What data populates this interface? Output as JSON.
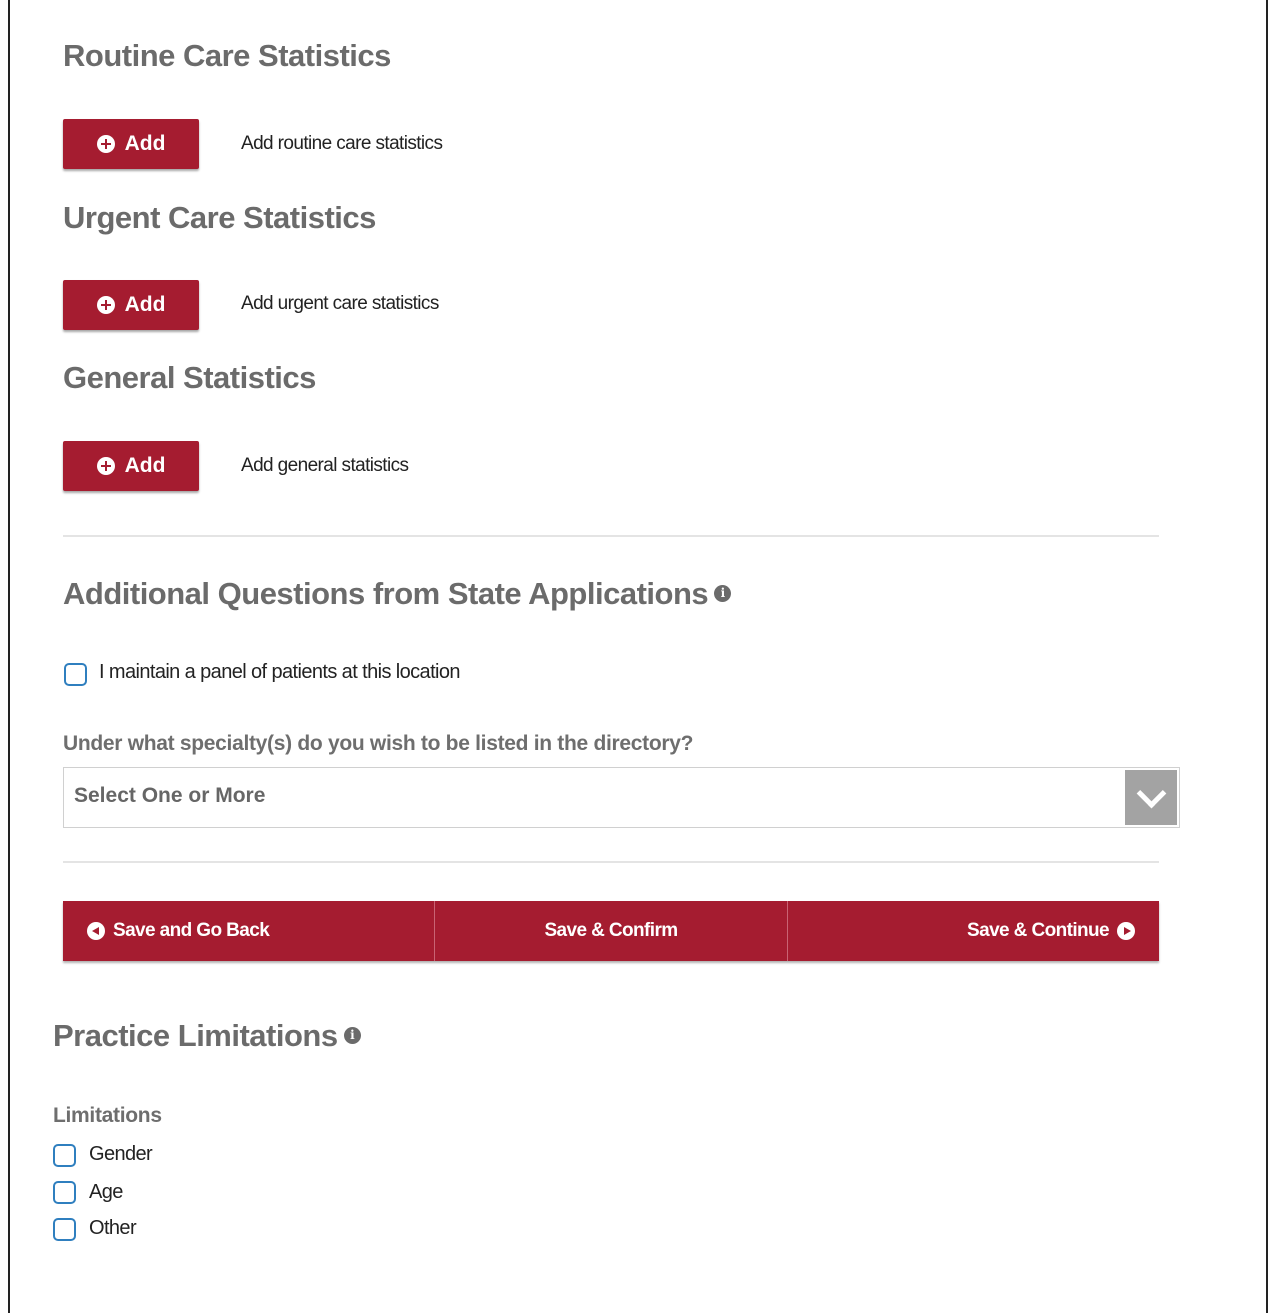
{
  "sections": {
    "routine": {
      "title": "Routine Care Statistics",
      "button": "Add",
      "description": "Add routine care statistics"
    },
    "urgent": {
      "title": "Urgent Care Statistics",
      "button": "Add",
      "description": "Add urgent care statistics"
    },
    "general": {
      "title": "General Statistics",
      "button": "Add",
      "description": "Add general statistics"
    }
  },
  "additional": {
    "title": "Additional Questions from State Applications",
    "panel_checkbox_label": "I maintain a panel of patients at this location",
    "specialty_label": "Under what specialty(s) do you wish to be listed in the directory?",
    "specialty_placeholder": "Select One or More"
  },
  "actions": {
    "back": "Save and Go Back",
    "confirm": "Save & Confirm",
    "continue": "Save & Continue"
  },
  "limitations": {
    "title": "Practice Limitations",
    "label": "Limitations",
    "options": [
      "Gender",
      "Age",
      "Other"
    ]
  },
  "colors": {
    "brand": "#a51c30",
    "heading": "#6b6b6b",
    "checkbox": "#2f7fbf"
  },
  "icons": {
    "add": "plus-circle-icon",
    "info": "info-icon",
    "dropdown": "chevron-down-icon",
    "back": "arrow-left-circle-icon",
    "forward": "arrow-right-circle-icon"
  }
}
